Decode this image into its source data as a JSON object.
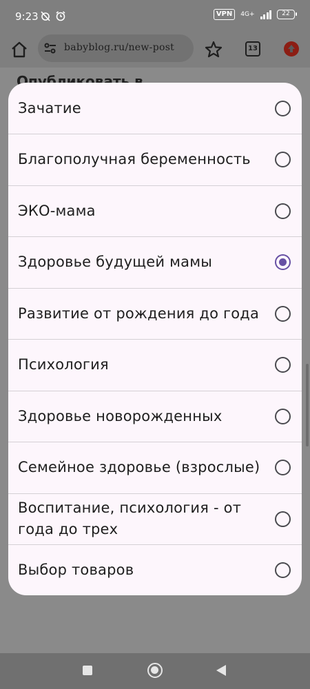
{
  "status_bar": {
    "time": "9:23",
    "icons": [
      "alarm-off-icon",
      "alarm-icon"
    ],
    "vpn": "VPN",
    "network": "4G+",
    "battery": "22"
  },
  "browser": {
    "url": "babyblog.ru/new-post",
    "tab_count": "13"
  },
  "page": {
    "heading": "Опубликовать в"
  },
  "dialog": {
    "options": [
      {
        "label": "Зачатие",
        "selected": false
      },
      {
        "label": "Благополучная беременность",
        "selected": false
      },
      {
        "label": "ЭКО-мама",
        "selected": false
      },
      {
        "label": "Здоровье будущей мамы",
        "selected": true
      },
      {
        "label": "Развитие от рождения до года",
        "selected": false
      },
      {
        "label": "Психология",
        "selected": false
      },
      {
        "label": "Здоровье новорожденных",
        "selected": false
      },
      {
        "label": "Семейное здоровье (взрослые)",
        "selected": false
      },
      {
        "label": "Воспитание, психология - от года до трех",
        "selected": false
      },
      {
        "label": "Выбор товаров",
        "selected": false
      }
    ]
  },
  "colors": {
    "accent": "#6750a4",
    "dialog_bg": "#fdf6fc",
    "scrim": "#8a8a8a"
  }
}
